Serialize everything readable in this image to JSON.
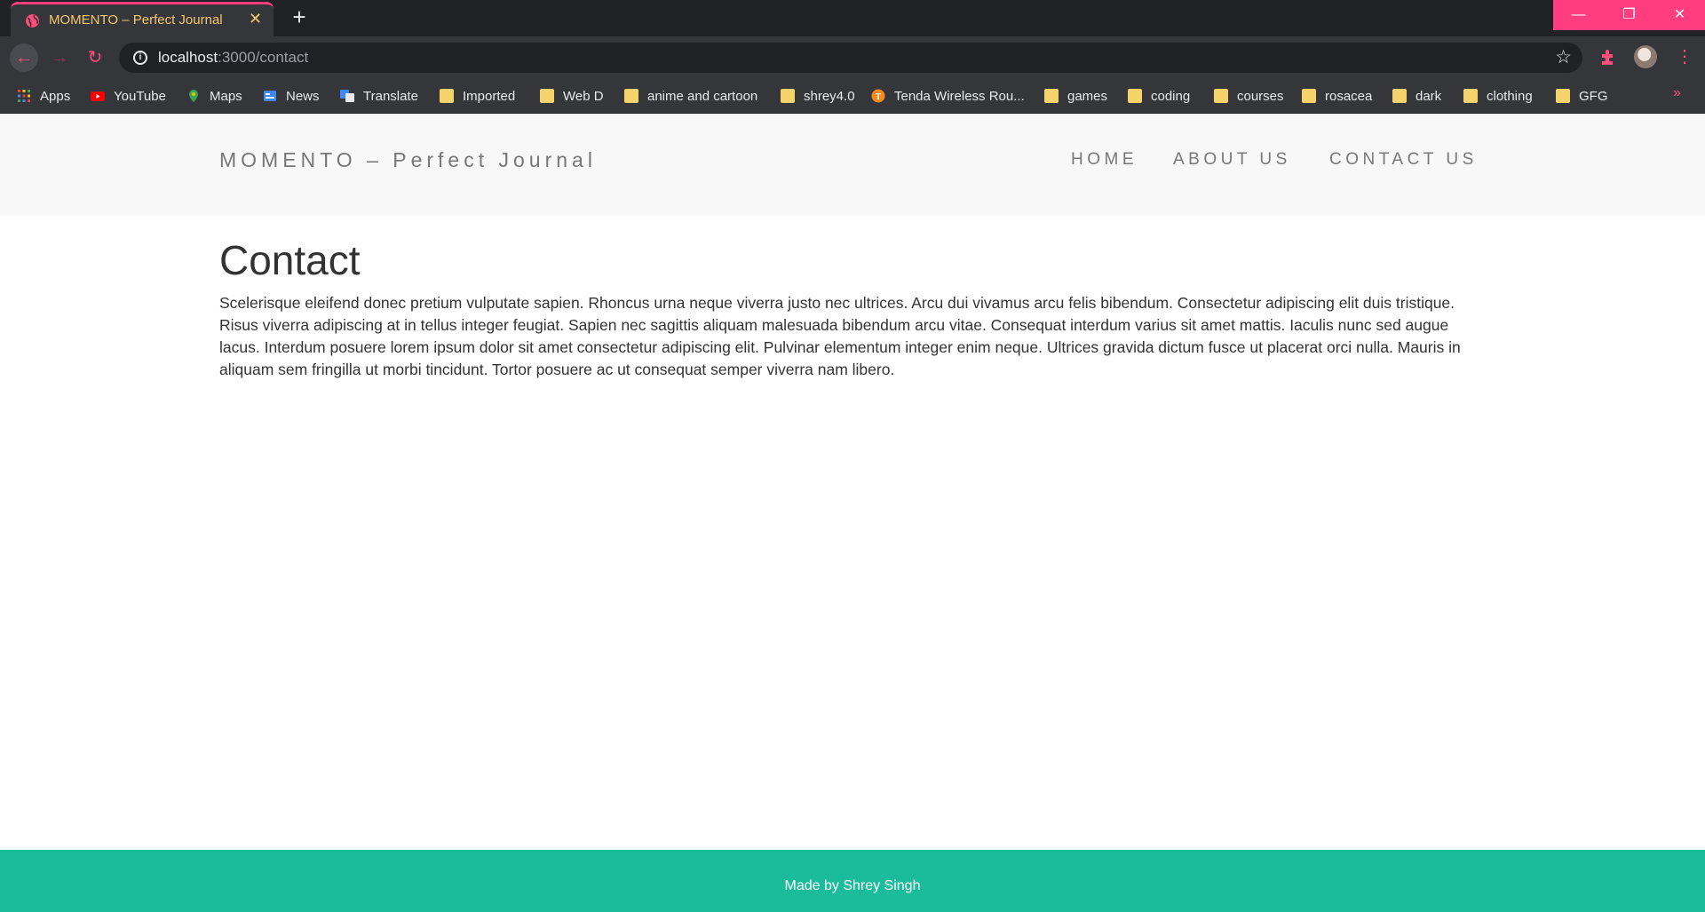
{
  "browser": {
    "tab_title": "MOMENTO – Perfect Journal",
    "tab_close": "✕",
    "new_tab": "+",
    "url_host": "localhost",
    "url_rest": ":3000/contact",
    "window_controls": {
      "minimize": "—",
      "restore": "❐",
      "close": "✕"
    },
    "bookmarks": [
      {
        "label": "Apps",
        "icon": "apps-grid-icon"
      },
      {
        "label": "YouTube",
        "icon": "youtube-icon"
      },
      {
        "label": "Maps",
        "icon": "maps-icon"
      },
      {
        "label": "News",
        "icon": "news-icon"
      },
      {
        "label": "Translate",
        "icon": "translate-icon"
      },
      {
        "label": "Imported",
        "icon": "folder-icon"
      },
      {
        "label": "Web D",
        "icon": "folder-icon"
      },
      {
        "label": "anime and cartoon",
        "icon": "folder-icon"
      },
      {
        "label": "shrey4.0",
        "icon": "folder-icon"
      },
      {
        "label": "Tenda Wireless Rou...",
        "icon": "tenda-icon"
      },
      {
        "label": "games",
        "icon": "folder-icon"
      },
      {
        "label": "coding",
        "icon": "folder-icon"
      },
      {
        "label": "courses",
        "icon": "folder-icon"
      },
      {
        "label": "rosacea",
        "icon": "folder-icon"
      },
      {
        "label": "dark",
        "icon": "folder-icon"
      },
      {
        "label": "clothing",
        "icon": "folder-icon"
      },
      {
        "label": "GFG",
        "icon": "folder-icon"
      }
    ],
    "bookmarks_more": "»",
    "colors": {
      "accent": "#ff3d7f",
      "tab_text": "#f6c56f",
      "chrome_bg": "#35363a"
    }
  },
  "site": {
    "brand": "MOMENTO – Perfect Journal",
    "nav": [
      "HOME",
      "ABOUT US",
      "CONTACT US"
    ],
    "title": "Contact",
    "body": "Scelerisque eleifend donec pretium vulputate sapien. Rhoncus urna neque viverra justo nec ultrices. Arcu dui vivamus arcu felis bibendum. Consectetur adipiscing elit duis tristique. Risus viverra adipiscing at in tellus integer feugiat. Sapien nec sagittis aliquam malesuada bibendum arcu vitae. Consequat interdum varius sit amet mattis. Iaculis nunc sed augue lacus. Interdum posuere lorem ipsum dolor sit amet consectetur adipiscing elit. Pulvinar elementum integer enim neque. Ultrices gravida dictum fusce ut placerat orci nulla. Mauris in aliquam sem fringilla ut morbi tincidunt. Tortor posuere ac ut consequat semper viverra nam libero.",
    "footer": "Made by Shrey Singh",
    "colors": {
      "footer_bg": "#1abc9c",
      "header_bg": "#f8f8f8"
    }
  }
}
